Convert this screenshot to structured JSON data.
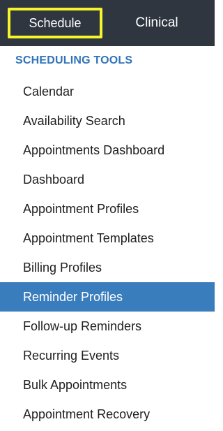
{
  "tabs": {
    "schedule_label": "Schedule",
    "clinical_label": "Clinical"
  },
  "section": {
    "heading": "SCHEDULING TOOLS"
  },
  "menu": {
    "items": [
      {
        "label": "Calendar",
        "active": false
      },
      {
        "label": "Availability Search",
        "active": false
      },
      {
        "label": "Appointments Dashboard",
        "active": false
      },
      {
        "label": "Dashboard",
        "active": false
      },
      {
        "label": "Appointment Profiles",
        "active": false
      },
      {
        "label": "Appointment Templates",
        "active": false
      },
      {
        "label": "Billing Profiles",
        "active": false
      },
      {
        "label": "Reminder Profiles",
        "active": true
      },
      {
        "label": "Follow-up Reminders",
        "active": false
      },
      {
        "label": "Recurring Events",
        "active": false
      },
      {
        "label": "Bulk Appointments",
        "active": false
      },
      {
        "label": "Appointment Recovery",
        "active": false
      }
    ]
  },
  "colors": {
    "topbar": "#2f3640",
    "highlight_border": "#f5f52a",
    "heading": "#2f73b8",
    "active_item": "#3a7dbd"
  }
}
